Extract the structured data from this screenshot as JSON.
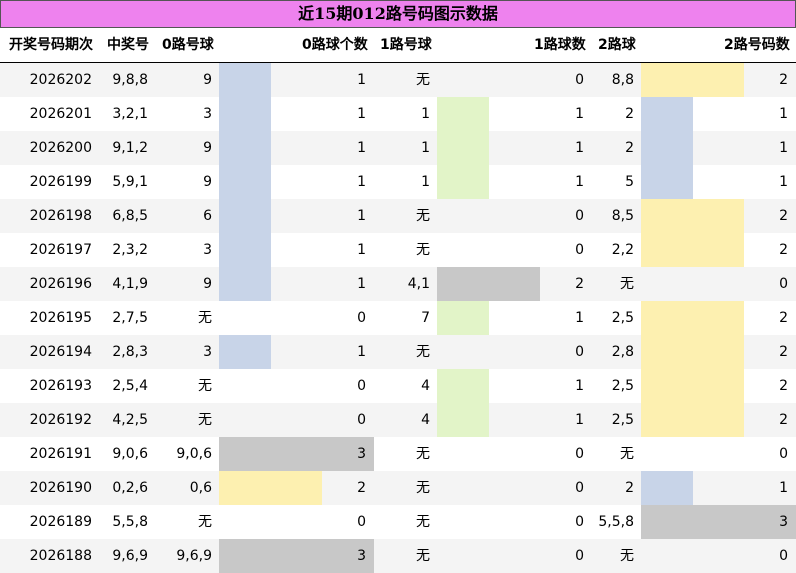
{
  "title": "近15期012路号码图示数据",
  "headers": [
    "开奖号码期次",
    "中奖号",
    "0路号球",
    "0路球个数",
    "1路号球",
    "1路球数",
    "2路球",
    "2路号码数"
  ],
  "colors": {
    "count1": "#c8d4e8",
    "count2": "#fdf0b0",
    "count3": "#c8c8c8",
    "count1_mid": "#e2f4c8",
    "count2_mid": "#c8c8c8",
    "title_bg": "#ee82ee"
  },
  "chart_data": {
    "type": "table",
    "title": "近15期012路号码图示数据",
    "columns": [
      "开奖号码期次",
      "中奖号",
      "0路号球",
      "0路球个数",
      "1路号球",
      "1路球数",
      "2路球",
      "2路号码数"
    ],
    "rows": [
      {
        "period": "2026202",
        "winning": "9,8,8",
        "r0": "9",
        "c0": 1,
        "r1": "无",
        "c1": 0,
        "r2": "8,8",
        "c2": 2
      },
      {
        "period": "2026201",
        "winning": "3,2,1",
        "r0": "3",
        "c0": 1,
        "r1": "1",
        "c1": 1,
        "r2": "2",
        "c2": 1
      },
      {
        "period": "2026200",
        "winning": "9,1,2",
        "r0": "9",
        "c0": 1,
        "r1": "1",
        "c1": 1,
        "r2": "2",
        "c2": 1
      },
      {
        "period": "2026199",
        "winning": "5,9,1",
        "r0": "9",
        "c0": 1,
        "r1": "1",
        "c1": 1,
        "r2": "5",
        "c2": 1
      },
      {
        "period": "2026198",
        "winning": "6,8,5",
        "r0": "6",
        "c0": 1,
        "r1": "无",
        "c1": 0,
        "r2": "8,5",
        "c2": 2
      },
      {
        "period": "2026197",
        "winning": "2,3,2",
        "r0": "3",
        "c0": 1,
        "r1": "无",
        "c1": 0,
        "r2": "2,2",
        "c2": 2
      },
      {
        "period": "2026196",
        "winning": "4,1,9",
        "r0": "9",
        "c0": 1,
        "r1": "4,1",
        "c1": 2,
        "r2": "无",
        "c2": 0
      },
      {
        "period": "2026195",
        "winning": "2,7,5",
        "r0": "无",
        "c0": 0,
        "r1": "7",
        "c1": 1,
        "r2": "2,5",
        "c2": 2
      },
      {
        "period": "2026194",
        "winning": "2,8,3",
        "r0": "3",
        "c0": 1,
        "r1": "无",
        "c1": 0,
        "r2": "2,8",
        "c2": 2
      },
      {
        "period": "2026193",
        "winning": "2,5,4",
        "r0": "无",
        "c0": 0,
        "r1": "4",
        "c1": 1,
        "r2": "2,5",
        "c2": 2
      },
      {
        "period": "2026192",
        "winning": "4,2,5",
        "r0": "无",
        "c0": 0,
        "r1": "4",
        "c1": 1,
        "r2": "2,5",
        "c2": 2
      },
      {
        "period": "2026191",
        "winning": "9,0,6",
        "r0": "9,0,6",
        "c0": 3,
        "r1": "无",
        "c1": 0,
        "r2": "无",
        "c2": 0
      },
      {
        "period": "2026190",
        "winning": "0,2,6",
        "r0": "0,6",
        "c0": 2,
        "r1": "无",
        "c1": 0,
        "r2": "2",
        "c2": 1
      },
      {
        "period": "2026189",
        "winning": "5,5,8",
        "r0": "无",
        "c0": 0,
        "r1": "无",
        "c1": 0,
        "r2": "5,5,8",
        "c2": 3
      },
      {
        "period": "2026188",
        "winning": "9,6,9",
        "r0": "9,6,9",
        "c0": 3,
        "r1": "无",
        "c1": 0,
        "r2": "无",
        "c2": 0
      }
    ]
  }
}
